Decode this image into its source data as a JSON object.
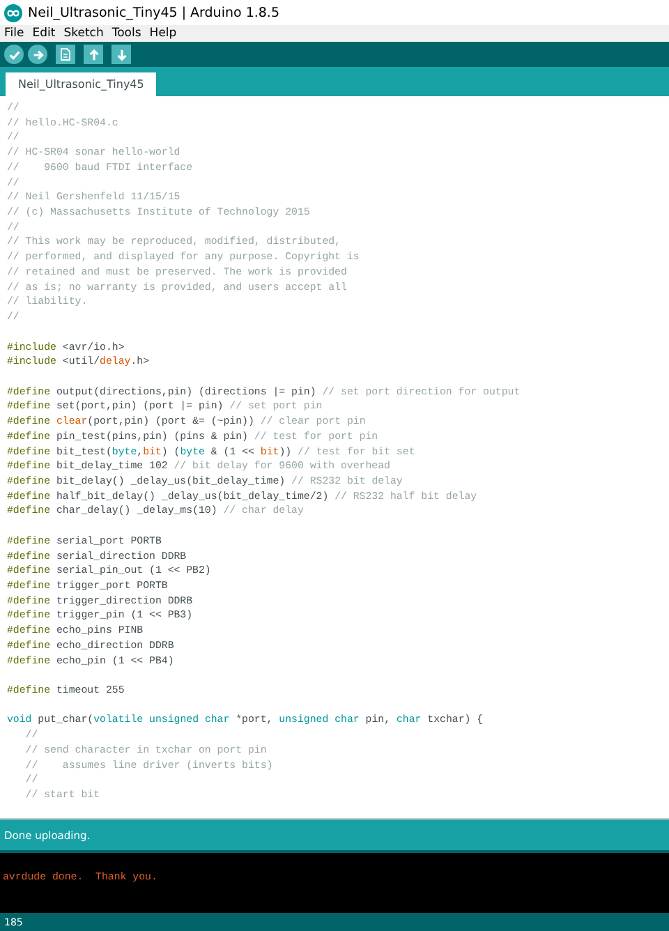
{
  "window": {
    "title": "Neil_Ultrasonic_Tiny45 | Arduino 1.8.5"
  },
  "menu": [
    "File",
    "Edit",
    "Sketch",
    "Tools",
    "Help"
  ],
  "toolbar": [
    {
      "kind": "verify"
    },
    {
      "kind": "upload"
    },
    {
      "kind": "new"
    },
    {
      "kind": "open"
    },
    {
      "kind": "save"
    }
  ],
  "tabs": [
    {
      "label": "Neil_Ultrasonic_Tiny45",
      "selected": true
    }
  ],
  "editor": {
    "blocks": [
      [
        [
          {
            "t": "//",
            "kind": "comment"
          }
        ],
        [
          {
            "t": "// hello.HC-SR04.c",
            "kind": "comment"
          }
        ],
        [
          {
            "t": "//",
            "kind": "comment"
          }
        ],
        [
          {
            "t": "// HC-SR04 sonar hello-world",
            "kind": "comment"
          }
        ],
        [
          {
            "t": "//    9600 baud FTDI interface",
            "kind": "comment"
          }
        ],
        [
          {
            "t": "//",
            "kind": "comment"
          }
        ],
        [
          {
            "t": "// Neil Gershenfeld 11/15/15",
            "kind": "comment"
          }
        ],
        [
          {
            "t": "// (c) Massachusetts Institute of Technology 2015",
            "kind": "comment"
          }
        ],
        [
          {
            "t": "//",
            "kind": "comment"
          }
        ],
        [
          {
            "t": "// This work may be reproduced, modified, distributed,",
            "kind": "comment"
          }
        ],
        [
          {
            "t": "// performed, and displayed for any purpose. Copyright is",
            "kind": "comment"
          }
        ],
        [
          {
            "t": "// retained and must be preserved. The work is provided",
            "kind": "comment"
          }
        ],
        [
          {
            "t": "// as is; no warranty is provided, and users accept all",
            "kind": "comment"
          }
        ],
        [
          {
            "t": "// liability.",
            "kind": "comment"
          }
        ],
        [
          {
            "t": "//",
            "kind": "comment"
          }
        ]
      ],
      [
        [
          {
            "t": "#include",
            "kind": "directive"
          },
          {
            "t": " <avr/io.h>",
            "kind": "plain"
          }
        ],
        [
          {
            "t": "#include",
            "kind": "directive"
          },
          {
            "t": " <util/",
            "kind": "plain"
          },
          {
            "t": "delay",
            "kind": "keyword"
          },
          {
            "t": ".h>",
            "kind": "plain"
          }
        ]
      ],
      [
        [
          {
            "t": "#define",
            "kind": "directive"
          },
          {
            "t": " output(directions,pin) (directions |= pin) ",
            "kind": "plain"
          },
          {
            "t": "// set port direction for output",
            "kind": "comment"
          }
        ],
        [
          {
            "t": "#define",
            "kind": "directive"
          },
          {
            "t": " set(port,pin) (port |= pin) ",
            "kind": "plain"
          },
          {
            "t": "// set port pin",
            "kind": "comment"
          }
        ],
        [
          {
            "t": "#define ",
            "kind": "directive"
          },
          {
            "t": "clear",
            "kind": "keyword"
          },
          {
            "t": "(port,pin) (port &= (~pin)) ",
            "kind": "plain"
          },
          {
            "t": "// clear port pin",
            "kind": "comment"
          }
        ],
        [
          {
            "t": "#define",
            "kind": "directive"
          },
          {
            "t": " pin_test(pins,pin) (pins & pin) ",
            "kind": "plain"
          },
          {
            "t": "// test for port pin",
            "kind": "comment"
          }
        ],
        [
          {
            "t": "#define",
            "kind": "directive"
          },
          {
            "t": " bit_test(",
            "kind": "plain"
          },
          {
            "t": "byte",
            "kind": "type"
          },
          {
            "t": ",",
            "kind": "plain"
          },
          {
            "t": "bit",
            "kind": "keyword"
          },
          {
            "t": ") (",
            "kind": "plain"
          },
          {
            "t": "byte",
            "kind": "type"
          },
          {
            "t": " & (1 << ",
            "kind": "plain"
          },
          {
            "t": "bit",
            "kind": "keyword"
          },
          {
            "t": ")) ",
            "kind": "plain"
          },
          {
            "t": "// test for bit set",
            "kind": "comment"
          }
        ],
        [
          {
            "t": "#define",
            "kind": "directive"
          },
          {
            "t": " bit_delay_time 102 ",
            "kind": "plain"
          },
          {
            "t": "// bit delay for 9600 with overhead",
            "kind": "comment"
          }
        ],
        [
          {
            "t": "#define",
            "kind": "directive"
          },
          {
            "t": " bit_delay() _delay_us(bit_delay_time) ",
            "kind": "plain"
          },
          {
            "t": "// RS232 bit delay",
            "kind": "comment"
          }
        ],
        [
          {
            "t": "#define",
            "kind": "directive"
          },
          {
            "t": " half_bit_delay() _delay_us(bit_delay_time/2) ",
            "kind": "plain"
          },
          {
            "t": "// RS232 half bit delay",
            "kind": "comment"
          }
        ],
        [
          {
            "t": "#define",
            "kind": "directive"
          },
          {
            "t": " char_delay() _delay_ms(10) ",
            "kind": "plain"
          },
          {
            "t": "// char delay",
            "kind": "comment"
          }
        ]
      ],
      [
        [
          {
            "t": "#define",
            "kind": "directive"
          },
          {
            "t": " serial_port PORTB",
            "kind": "plain"
          }
        ],
        [
          {
            "t": "#define",
            "kind": "directive"
          },
          {
            "t": " serial_direction DDRB",
            "kind": "plain"
          }
        ],
        [
          {
            "t": "#define",
            "kind": "directive"
          },
          {
            "t": " serial_pin_out (1 << PB2)",
            "kind": "plain"
          }
        ],
        [
          {
            "t": "#define",
            "kind": "directive"
          },
          {
            "t": " trigger_port PORTB",
            "kind": "plain"
          }
        ],
        [
          {
            "t": "#define",
            "kind": "directive"
          },
          {
            "t": " trigger_direction DDRB",
            "kind": "plain"
          }
        ],
        [
          {
            "t": "#define",
            "kind": "directive"
          },
          {
            "t": " trigger_pin (1 << PB3)",
            "kind": "plain"
          }
        ],
        [
          {
            "t": "#define",
            "kind": "directive"
          },
          {
            "t": " echo_pins PINB",
            "kind": "plain"
          }
        ],
        [
          {
            "t": "#define",
            "kind": "directive"
          },
          {
            "t": " echo_direction DDRB",
            "kind": "plain"
          }
        ],
        [
          {
            "t": "#define",
            "kind": "directive"
          },
          {
            "t": " echo_pin (1 << PB4)",
            "kind": "plain"
          }
        ]
      ],
      [
        [
          {
            "t": "#define",
            "kind": "directive"
          },
          {
            "t": " timeout 255",
            "kind": "plain"
          }
        ]
      ],
      [
        [
          {
            "t": "void",
            "kind": "type"
          },
          {
            "t": " put_char(",
            "kind": "plain"
          },
          {
            "t": "volatile unsigned char",
            "kind": "type"
          },
          {
            "t": " *port, ",
            "kind": "plain"
          },
          {
            "t": "unsigned char",
            "kind": "type"
          },
          {
            "t": " pin, ",
            "kind": "plain"
          },
          {
            "t": "char",
            "kind": "type"
          },
          {
            "t": " txchar) {",
            "kind": "plain"
          }
        ],
        [
          {
            "t": "   //",
            "kind": "comment"
          }
        ],
        [
          {
            "t": "   // send character in txchar on port pin",
            "kind": "comment"
          }
        ],
        [
          {
            "t": "   //    assumes line driver (inverts bits)",
            "kind": "comment"
          }
        ],
        [
          {
            "t": "   //",
            "kind": "comment"
          }
        ],
        [
          {
            "t": "   // start bit",
            "kind": "comment"
          }
        ]
      ]
    ]
  },
  "status": "Done uploading.",
  "console": [
    "avrdude done.  Thank you."
  ],
  "line_number": "185"
}
